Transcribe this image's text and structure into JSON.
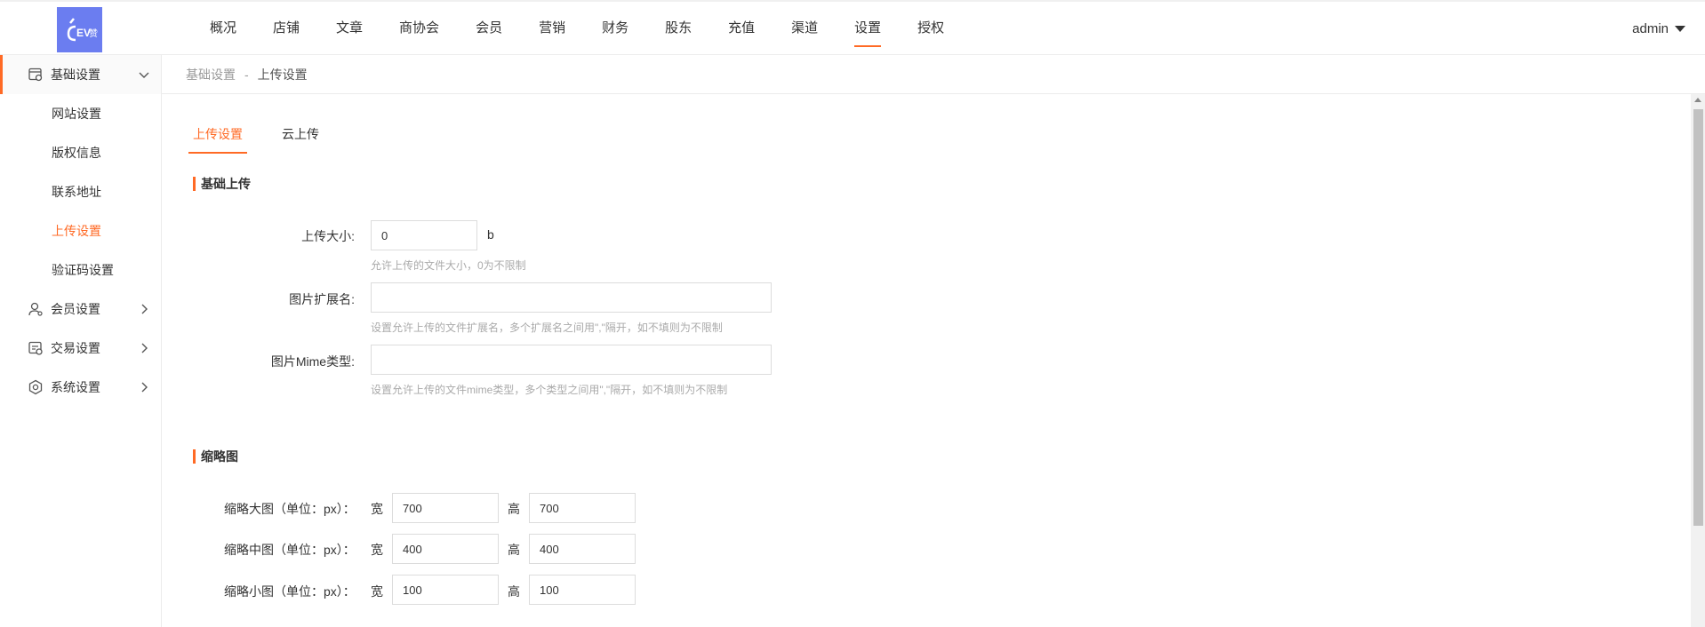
{
  "header": {
    "logo_text": "EV赞",
    "nav": [
      "概况",
      "店铺",
      "文章",
      "商协会",
      "会员",
      "营销",
      "财务",
      "股东",
      "充值",
      "渠道",
      "设置",
      "授权"
    ],
    "active_nav": "设置",
    "user": "admin"
  },
  "sidebar": {
    "groups": [
      {
        "label": "基础设置",
        "icon": "settings-box-icon",
        "open": true,
        "items": [
          "网站设置",
          "版权信息",
          "联系地址",
          "上传设置",
          "验证码设置"
        ],
        "active_item": "上传设置"
      },
      {
        "label": "会员设置",
        "icon": "user-icon",
        "open": false
      },
      {
        "label": "交易设置",
        "icon": "transaction-icon",
        "open": false
      },
      {
        "label": "系统设置",
        "icon": "gear-icon",
        "open": false
      }
    ]
  },
  "breadcrumb": {
    "parent": "基础设置",
    "separator": "-",
    "current": "上传设置"
  },
  "tabs": [
    "上传设置",
    "云上传"
  ],
  "active_tab": "上传设置",
  "basic_upload": {
    "title": "基础上传",
    "size": {
      "label": "上传大小:",
      "value": "0",
      "unit": "b",
      "help": "允许上传的文件大小，0为不限制"
    },
    "ext": {
      "label": "图片扩展名:",
      "value": "",
      "help": "设置允许上传的文件扩展名，多个扩展名之间用\",\"隔开，如不填则为不限制"
    },
    "mime": {
      "label": "图片Mime类型:",
      "value": "",
      "help": "设置允许上传的文件mime类型，多个类型之间用\",\"隔开，如不填则为不限制"
    }
  },
  "thumbnail": {
    "title": "缩略图",
    "width_label": "宽",
    "height_label": "高",
    "rows": [
      {
        "label": "缩略大图（单位：px）：",
        "width": "700",
        "height": "700"
      },
      {
        "label": "缩略中图（单位：px）：",
        "width": "400",
        "height": "400"
      },
      {
        "label": "缩略小图（单位：px）：",
        "width": "100",
        "height": "100"
      }
    ]
  },
  "colors": {
    "accent": "#ff6a25",
    "logo_bg": "#6b7df0"
  }
}
